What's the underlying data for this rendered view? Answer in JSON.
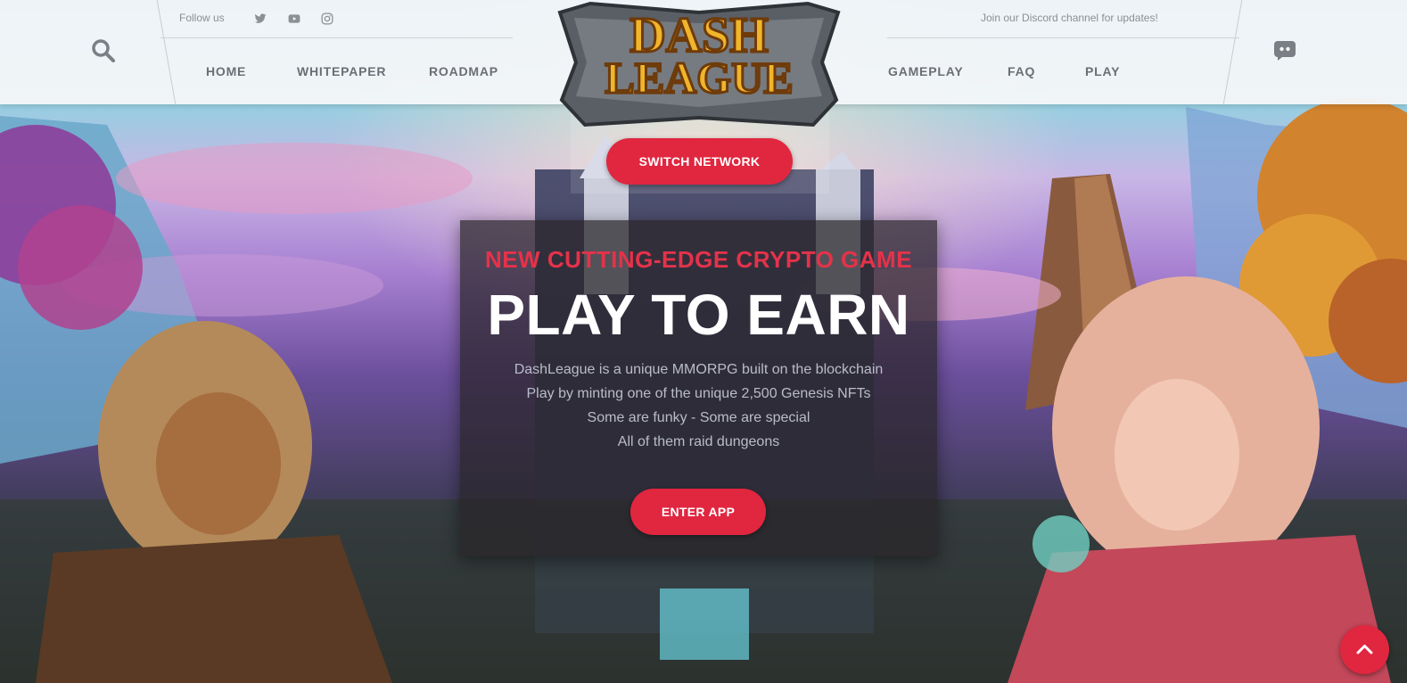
{
  "header": {
    "follow_label": "Follow us",
    "social_icons": [
      "twitter-icon",
      "youtube-icon",
      "instagram-icon"
    ],
    "discord_note": "Join our Discord channel for updates!",
    "nav_left": [
      "HOME",
      "WHITEPAPER",
      "ROADMAP"
    ],
    "nav_right": [
      "GAMEPLAY",
      "FAQ",
      "PLAY"
    ]
  },
  "logo": {
    "line1": "DASH",
    "line2": "LEAGUE"
  },
  "switch_network_label": "SWITCH NETWORK",
  "hero": {
    "kicker": "NEW CUTTING-EDGE CRYPTO GAME",
    "headline": "PLAY TO EARN",
    "lines": [
      "DashLeague is a unique MMORPG built on the blockchain",
      "Play by minting one of the unique 2,500 Genesis NFTs",
      "Some are funky - Some are special",
      "All of them raid dungeons"
    ],
    "cta_label": "ENTER APP"
  },
  "colors": {
    "accent": "#e1263f",
    "header_bg": "#f4f6f8",
    "nav_text": "#6b6f75"
  }
}
